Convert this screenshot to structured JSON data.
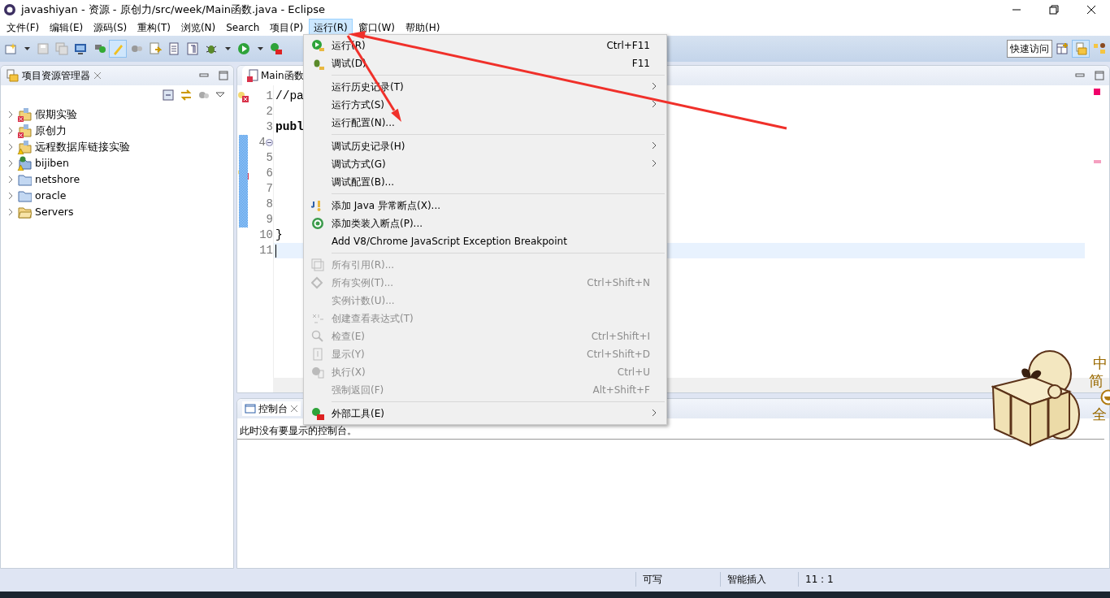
{
  "window": {
    "title": "javashiyan  -  资源  -  原创力/src/week/Main函数.java  -  Eclipse"
  },
  "menu_bar": [
    {
      "label": "文件(F)",
      "selected": false
    },
    {
      "label": "编辑(E)",
      "selected": false
    },
    {
      "label": "源码(S)",
      "selected": false
    },
    {
      "label": "重构(T)",
      "selected": false
    },
    {
      "label": "浏览(N)",
      "selected": false
    },
    {
      "label": "Search",
      "selected": false
    },
    {
      "label": "项目(P)",
      "selected": false
    },
    {
      "label": "运行(R)",
      "selected": true
    },
    {
      "label": "窗口(W)",
      "selected": false
    },
    {
      "label": "帮助(H)",
      "selected": false
    }
  ],
  "quick_access": {
    "placeholder": "快速访问"
  },
  "project_explorer": {
    "title": "项目资源管理器",
    "items": [
      {
        "name": "假期实验",
        "kind": "project",
        "error": true,
        "warning": false
      },
      {
        "name": "原创力",
        "kind": "project",
        "error": true,
        "warning": false
      },
      {
        "name": "远程数据库链接实验",
        "kind": "project",
        "error": false,
        "warning": true
      },
      {
        "name": "bijiben",
        "kind": "web-project",
        "error": false,
        "warning": true
      },
      {
        "name": "netshore",
        "kind": "folder",
        "error": false,
        "warning": false
      },
      {
        "name": "oracle",
        "kind": "folder",
        "error": false,
        "warning": false
      },
      {
        "name": "Servers",
        "kind": "open-folder",
        "error": false,
        "warning": false
      }
    ]
  },
  "editor": {
    "tab": "Main函数",
    "lines": [
      {
        "number": "1",
        "code": "//pa",
        "problem": true,
        "fold": false,
        "cursor": false
      },
      {
        "number": "2",
        "problem": false,
        "fold": false,
        "cursor": false
      },
      {
        "number": "3",
        "code": "**publ**",
        "problem": false,
        "fold": false,
        "cursor": false
      },
      {
        "number": "4",
        "problem": false,
        "fold": true,
        "cursor": false
      },
      {
        "number": "5",
        "problem": false,
        "fold": false,
        "cursor": false
      },
      {
        "number": "6",
        "problem": true,
        "fold": false,
        "cursor": false
      },
      {
        "number": "7",
        "problem": false,
        "fold": false,
        "cursor": false
      },
      {
        "number": "8",
        "problem": false,
        "fold": false,
        "cursor": false
      },
      {
        "number": "9",
        "problem": false,
        "fold": false,
        "cursor": false
      },
      {
        "number": "10",
        "code": "}",
        "problem": false,
        "fold": false,
        "cursor": false
      },
      {
        "number": "11",
        "problem": false,
        "fold": false,
        "cursor": true
      }
    ]
  },
  "run_menu": {
    "groups": [
      [
        {
          "label": "运行(R)",
          "shortcut": "Ctrl+F11",
          "submenu": false,
          "disabled": false
        },
        {
          "label": "调试(D)",
          "shortcut": "F11",
          "submenu": false,
          "disabled": false
        }
      ],
      [
        {
          "label": "运行历史记录(T)",
          "submenu": true,
          "disabled": false
        },
        {
          "label": "运行方式(S)",
          "submenu": true,
          "disabled": false
        },
        {
          "label": "运行配置(N)...",
          "submenu": false,
          "disabled": false
        }
      ],
      [
        {
          "label": "调试历史记录(H)",
          "submenu": true,
          "disabled": false
        },
        {
          "label": "调试方式(G)",
          "submenu": true,
          "disabled": false
        },
        {
          "label": "调试配置(B)...",
          "submenu": false,
          "disabled": false
        }
      ],
      [
        {
          "label": "添加 Java 异常断点(X)...",
          "submenu": false,
          "disabled": false
        },
        {
          "label": "添加类装入断点(P)...",
          "submenu": false,
          "disabled": false
        },
        {
          "label": "Add V8/Chrome JavaScript Exception Breakpoint",
          "submenu": false,
          "disabled": false
        }
      ],
      [
        {
          "label": "所有引用(R)...",
          "submenu": false,
          "disabled": true
        },
        {
          "label": "所有实例(T)...",
          "shortcut": "Ctrl+Shift+N",
          "submenu": false,
          "disabled": true
        },
        {
          "label": "实例计数(U)...",
          "submenu": false,
          "disabled": true
        },
        {
          "label": "创建查看表达式(T)",
          "submenu": false,
          "disabled": true
        },
        {
          "label": "检查(E)",
          "shortcut": "Ctrl+Shift+I",
          "submenu": false,
          "disabled": true
        },
        {
          "label": "显示(Y)",
          "shortcut": "Ctrl+Shift+D",
          "submenu": false,
          "disabled": true
        },
        {
          "label": "执行(X)",
          "shortcut": "Ctrl+U",
          "submenu": false,
          "disabled": true
        },
        {
          "label": "强制返回(F)",
          "shortcut": "Alt+Shift+F",
          "submenu": false,
          "disabled": true
        }
      ],
      [
        {
          "label": "外部工具(E)",
          "submenu": true,
          "disabled": false
        }
      ]
    ]
  },
  "console": {
    "tab": "控制台",
    "message": "此时没有要显示的控制台。"
  },
  "status_bar": {
    "mode": "可写",
    "insert": "智能插入",
    "position": "11 : 1"
  },
  "ime": {
    "language": "中",
    "script": "简",
    "width": "全"
  }
}
